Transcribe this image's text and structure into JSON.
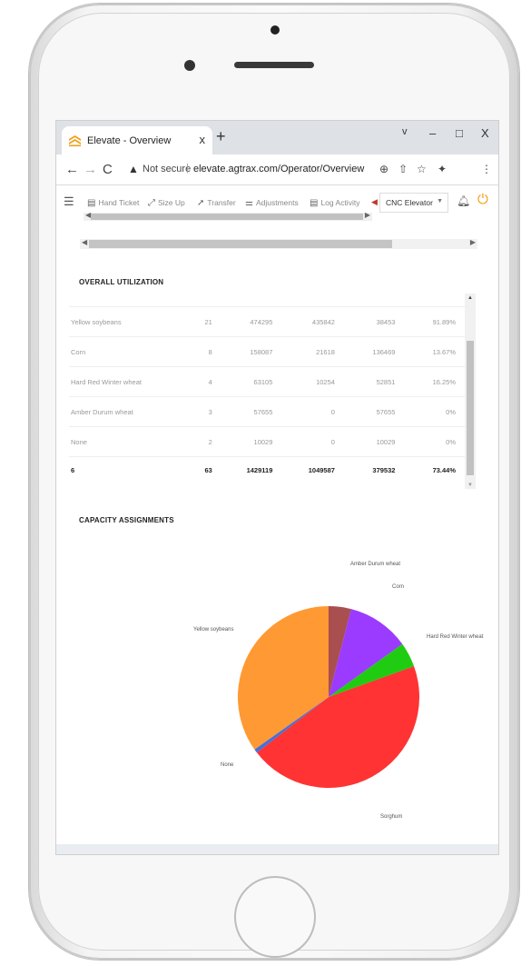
{
  "browser": {
    "tab_title": "Elevate - Overview",
    "tab_close": "x",
    "new_tab": "+",
    "minimize": "–",
    "maximize": "□",
    "close": "X",
    "dropdown": "v",
    "security_label": "Not secure",
    "separator": "|",
    "url": "elevate.agtrax.com/Operator/Overview"
  },
  "toolbar": {
    "items": [
      {
        "label": "Hand Ticket",
        "icon": "ticket-icon"
      },
      {
        "label": "Size Up",
        "icon": "resize-icon"
      },
      {
        "label": "Transfer",
        "icon": "transfer-icon"
      },
      {
        "label": "Adjustments",
        "icon": "sliders-icon"
      },
      {
        "label": "Log Activity",
        "icon": "log-icon"
      }
    ],
    "location": "CNC Elevator"
  },
  "sections": {
    "utilization_title": "OVERALL UTILIZATION",
    "capacity_title": "CAPACITY ASSIGNMENTS"
  },
  "utilization": {
    "rows": [
      [
        "Yellow soybeans",
        "21",
        "474295",
        "435842",
        "38453",
        "91.89%"
      ],
      [
        "Corn",
        "8",
        "158087",
        "21618",
        "136469",
        "13.67%"
      ],
      [
        "Hard Red Winter wheat",
        "4",
        "63105",
        "10254",
        "52851",
        "16.25%"
      ],
      [
        "Amber Durum wheat",
        "3",
        "57655",
        "0",
        "57655",
        "0%"
      ],
      [
        "None",
        "2",
        "10029",
        "0",
        "10029",
        "0%"
      ]
    ],
    "total": [
      "6",
      "63",
      "1429119",
      "1049587",
      "379532",
      "73.44%"
    ]
  },
  "chart_data": {
    "type": "pie",
    "title": "",
    "slices": [
      {
        "label": "Amber Durum wheat",
        "value": 4.0,
        "color": "#a94f4f"
      },
      {
        "label": "Corn",
        "value": 11.1,
        "color": "#9b3bff"
      },
      {
        "label": "Hard Red Winter wheat",
        "value": 4.4,
        "color": "#1fcc12"
      },
      {
        "label": "Sorghum",
        "value": 45.0,
        "color": "#ff3333"
      },
      {
        "label": "None",
        "value": 0.7,
        "color": "#4a6fd6"
      },
      {
        "label": "Yellow soybeans",
        "value": 34.8,
        "color": "#ff9933"
      }
    ]
  }
}
